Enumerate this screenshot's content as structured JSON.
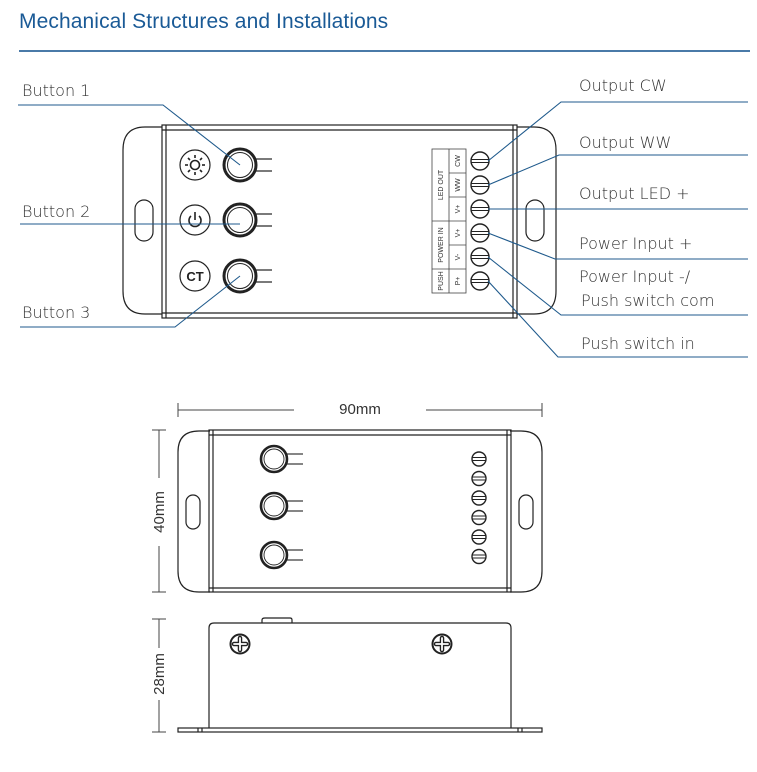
{
  "title": "Mechanical Structures and Installations",
  "colors": {
    "title": "#1a5a96",
    "leader": "#1f5a8c",
    "rule": "#4a7aa8",
    "outline": "#222222"
  },
  "left_labels": [
    "Button 1",
    "Button 2",
    "Button 3"
  ],
  "right_labels": [
    "Output CW",
    "Output WW",
    "Output LED +",
    "Power Input +",
    "Power Input -/",
    "Push switch com",
    "Push switch in"
  ],
  "button_icons": {
    "b1": "brightness-sun-icon",
    "b2": "power-icon",
    "b3": "CT"
  },
  "terminal_table": {
    "groups": [
      "LED OUT",
      "POWER IN",
      "PUSH"
    ],
    "pins": [
      "CW",
      "WW",
      "V+",
      "V+",
      "V-",
      "P+"
    ]
  },
  "dimensions": {
    "width": "90mm",
    "height": "40mm",
    "depth": "28mm"
  }
}
